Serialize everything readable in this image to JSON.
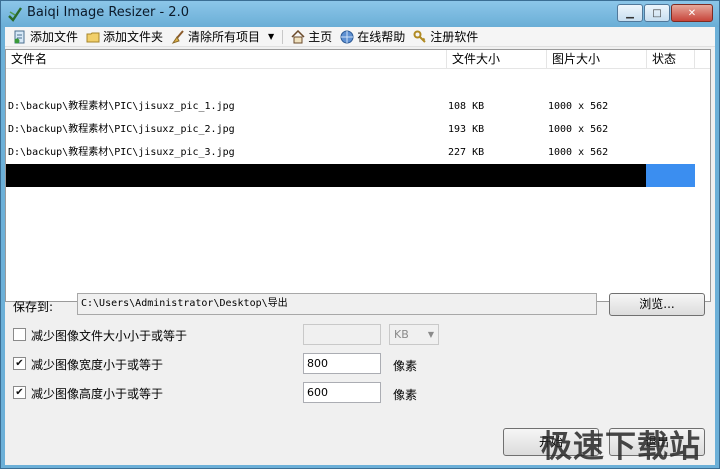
{
  "window": {
    "title": "Baiqi Image Resizer - 2.0"
  },
  "toolbar": {
    "add_file": "添加文件",
    "add_folder": "添加文件夹",
    "clear_all": "清除所有项目",
    "home": "主页",
    "online_help": "在线帮助",
    "register": "注册软件"
  },
  "list": {
    "columns": [
      "文件名",
      "文件大小",
      "图片大小",
      "状态"
    ],
    "rows": [
      {
        "name": "D:\\backup\\教程素材\\PIC\\jisuxz_pic_1.jpg",
        "size": "108 KB",
        "dims": "1000 x 562",
        "status": ""
      },
      {
        "name": "D:\\backup\\教程素材\\PIC\\jisuxz_pic_2.jpg",
        "size": "193 KB",
        "dims": "1000 x 562",
        "status": ""
      },
      {
        "name": "D:\\backup\\教程素材\\PIC\\jisuxz_pic_3.jpg",
        "size": "227 KB",
        "dims": "1000 x 562",
        "status": ""
      }
    ]
  },
  "save": {
    "label": "保存到:",
    "path": "C:\\Users\\Administrator\\Desktop\\导出",
    "browse": "浏览..."
  },
  "options": {
    "reduce_filesize": {
      "label": "减少图像文件大小小于或等于",
      "checked": false,
      "value": "",
      "unit": "KB"
    },
    "reduce_width": {
      "label": "减少图像宽度小于或等于",
      "checked": true,
      "value": "800",
      "unit": "像素"
    },
    "reduce_height": {
      "label": "减少图像高度小于或等于",
      "checked": true,
      "value": "600",
      "unit": "像素"
    }
  },
  "actions": {
    "start": "开始",
    "cancel": "退出"
  },
  "watermark": "极速下载站",
  "colors": {
    "accent": "#3b8ef0",
    "title_bar": "#6cb0d8"
  }
}
